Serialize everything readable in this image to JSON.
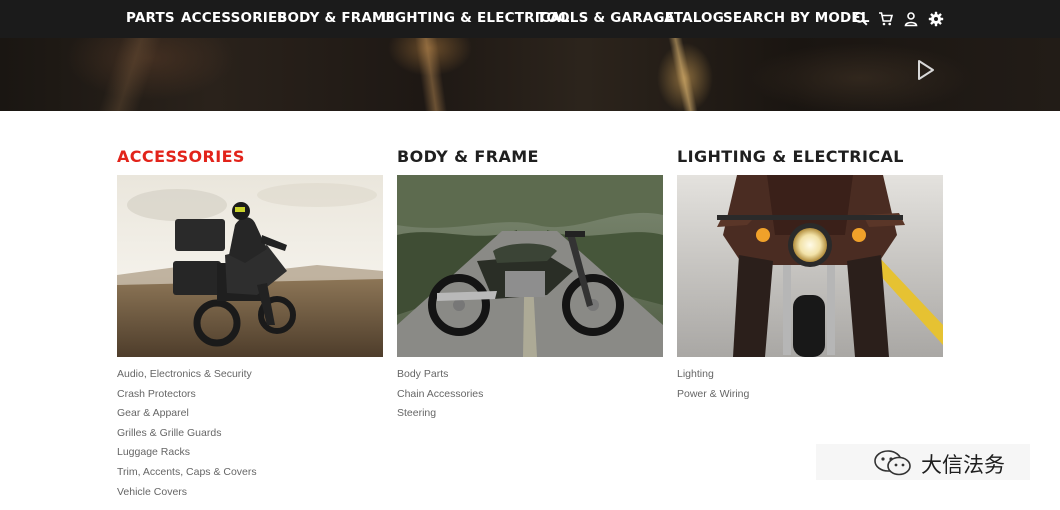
{
  "nav": {
    "items": [
      "PARTS",
      "ACCESSORIES",
      "BODY & FRAME",
      "LIGHTING & ELECTRICAL",
      "TOOLS & GARAGE",
      "CATALOG",
      "SEARCH BY MODEL"
    ],
    "icons": [
      "search-icon",
      "cart-icon",
      "user-icon",
      "gear-icon"
    ]
  },
  "hero": {
    "icon": "play-icon"
  },
  "categories": [
    {
      "title": "ACCESSORIES",
      "active": true,
      "image": "adventure-motorcycle-with-panniers-photo",
      "links": [
        "Audio, Electronics & Security",
        "Crash Protectors",
        "Gear & Apparel",
        "Grilles & Grille Guards",
        "Luggage Racks",
        "Trim, Accents, Caps & Covers",
        "Vehicle Covers"
      ]
    },
    {
      "title": "BODY & FRAME",
      "active": false,
      "image": "cafe-racer-motorcycle-on-road-photo",
      "links": [
        "Body Parts",
        "Chain Accessories",
        "Steering"
      ]
    },
    {
      "title": "LIGHTING & ELECTRICAL",
      "active": false,
      "image": "motorcycle-headlight-front-view-photo",
      "links": [
        "Lighting",
        "Power & Wiring"
      ]
    }
  ],
  "watermark": {
    "text": "大信法务"
  },
  "colors": {
    "accent": "#e2231a",
    "nav_bg": "#1b1b1b",
    "link_text": "#666666"
  }
}
